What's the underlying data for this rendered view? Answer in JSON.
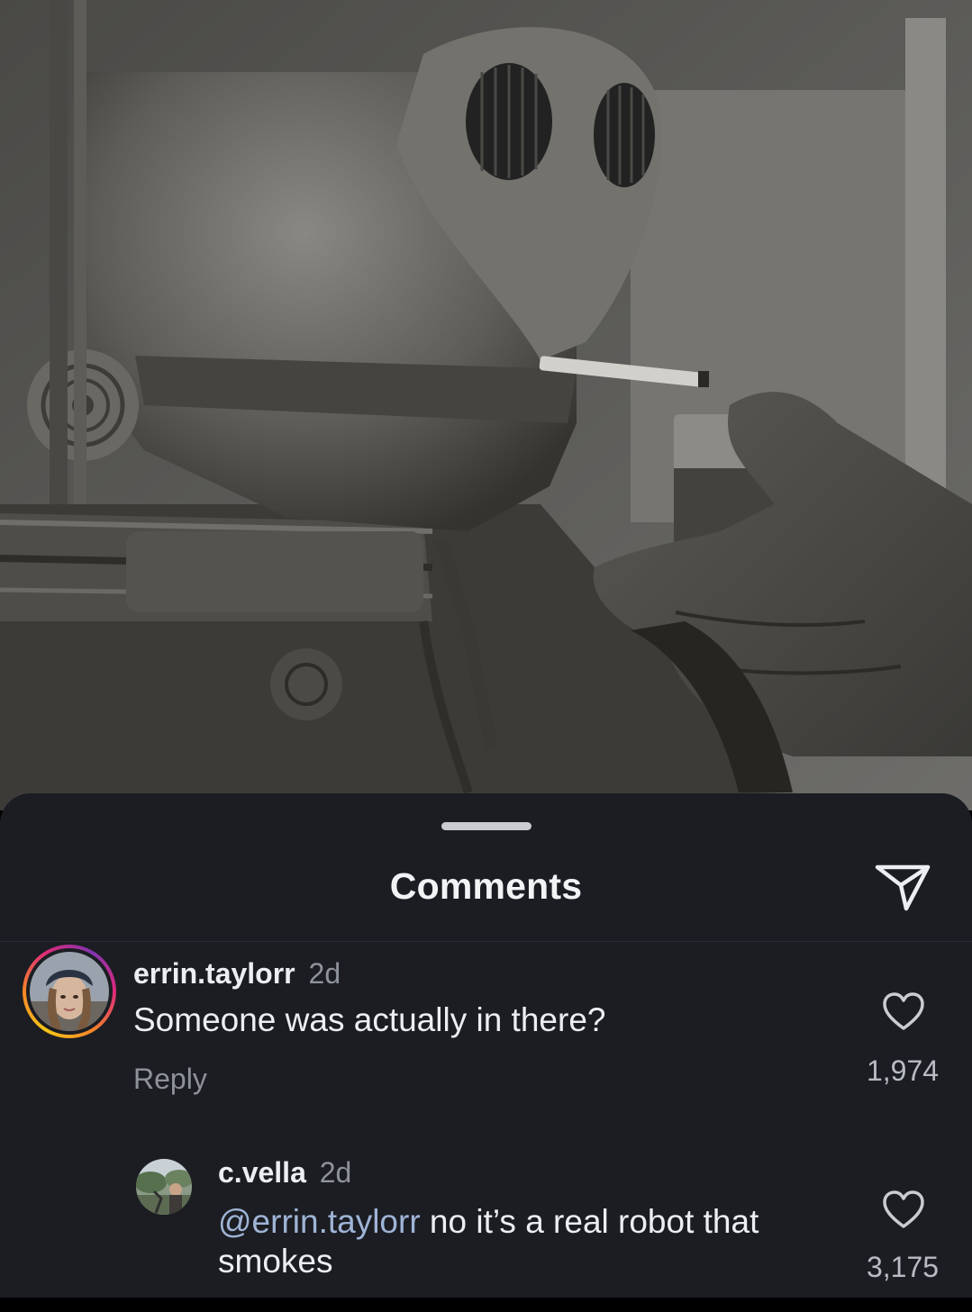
{
  "sheet": {
    "title": "Comments"
  },
  "comments": [
    {
      "username": "errin.taylorr",
      "time": "2d",
      "text": "Someone was actually in there?",
      "reply_label": "Reply",
      "likes": "1,974"
    },
    {
      "username": "c.vella",
      "time": "2d",
      "mention": "@errin.taylorr",
      "text": " no it’s a real robot that smokes",
      "likes": "3,175"
    }
  ],
  "icons": {
    "share": "paper-plane-icon",
    "like": "heart-outline-icon"
  },
  "colors": {
    "sheet_bg": "#1b1d22",
    "mention": "#9fb4d6",
    "story_ring": "#dd2a7b"
  }
}
